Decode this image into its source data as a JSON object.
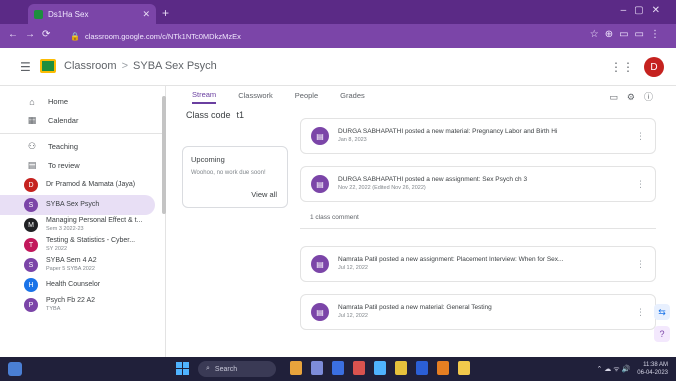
{
  "browser": {
    "tab_title": "Ds1Ha Sex",
    "url": "classroom.google.com/c/NTk1NTc0MDkzMzEx",
    "colors": {
      "tabbar": "#5b2a86",
      "addrbar": "#7b45a8"
    }
  },
  "header": {
    "app_name": "Classroom",
    "breadcrumb_sep": ">",
    "class_name": "SYBA Sex Psych",
    "avatar_initial": "D"
  },
  "sidebar": {
    "nav": [
      {
        "label": "Home",
        "icon": "home-icon"
      },
      {
        "label": "Calendar",
        "icon": "calendar-icon"
      }
    ],
    "teaching": [
      {
        "label": "Teaching",
        "icon": "people-icon"
      },
      {
        "label": "To review",
        "icon": "review-icon"
      }
    ],
    "classes": [
      {
        "title": "Dr Pramod & Mamata (Jaya)",
        "sub": "",
        "color": "#c5221f",
        "initial": "D"
      },
      {
        "title": "SYBA Sex Psych",
        "sub": "",
        "color": "#7b45a8",
        "initial": "S",
        "active": true
      },
      {
        "title": "Managing Personal Effect & t...",
        "sub": "Sem 3 2022-23",
        "color": "#202124",
        "initial": "M"
      },
      {
        "title": "Testing & Statistics - Cyber...",
        "sub": "SY 2022",
        "color": "#c2185b",
        "initial": "T"
      },
      {
        "title": "SYBA Sem 4 A2",
        "sub": "Paper 5 SYBA 2022",
        "color": "#7b45a8",
        "initial": "S"
      },
      {
        "title": "Health Counselor",
        "sub": "",
        "color": "#1a73e8",
        "initial": "H"
      },
      {
        "title": "Psych Fb 22 A2",
        "sub": "TYBA",
        "color": "#7b45a8",
        "initial": "P"
      }
    ]
  },
  "class_tabs": [
    "Stream",
    "Classwork",
    "People",
    "Grades"
  ],
  "class_code": {
    "label": "Class code",
    "value": "t1"
  },
  "upcoming": {
    "heading": "Upcoming",
    "subtext": "Woohoo, no work due soon!",
    "view_all": "View all"
  },
  "posts": [
    {
      "text": "DURGA SABHAPATHI posted a new material: Pregnancy  Labor and Birth Hi",
      "date": "Jan 8, 2023"
    },
    {
      "text": "DURGA SABHAPATHI posted a new assignment: Sex Psych ch 3",
      "date": "Nov 22, 2022 (Edited Nov 26, 2022)"
    },
    {
      "text": "Namrata Patil posted a new assignment: Placement Interview: When  for Sex...",
      "date": "Jul 12, 2022"
    },
    {
      "text": "Namrata Patil posted a new material: General Testing",
      "date": "Jul 12, 2022"
    }
  ],
  "class_comment": "1 class comment",
  "taskbar": {
    "search_placeholder": "Search",
    "time": "11:38 AM",
    "date": "06-04-2023"
  }
}
